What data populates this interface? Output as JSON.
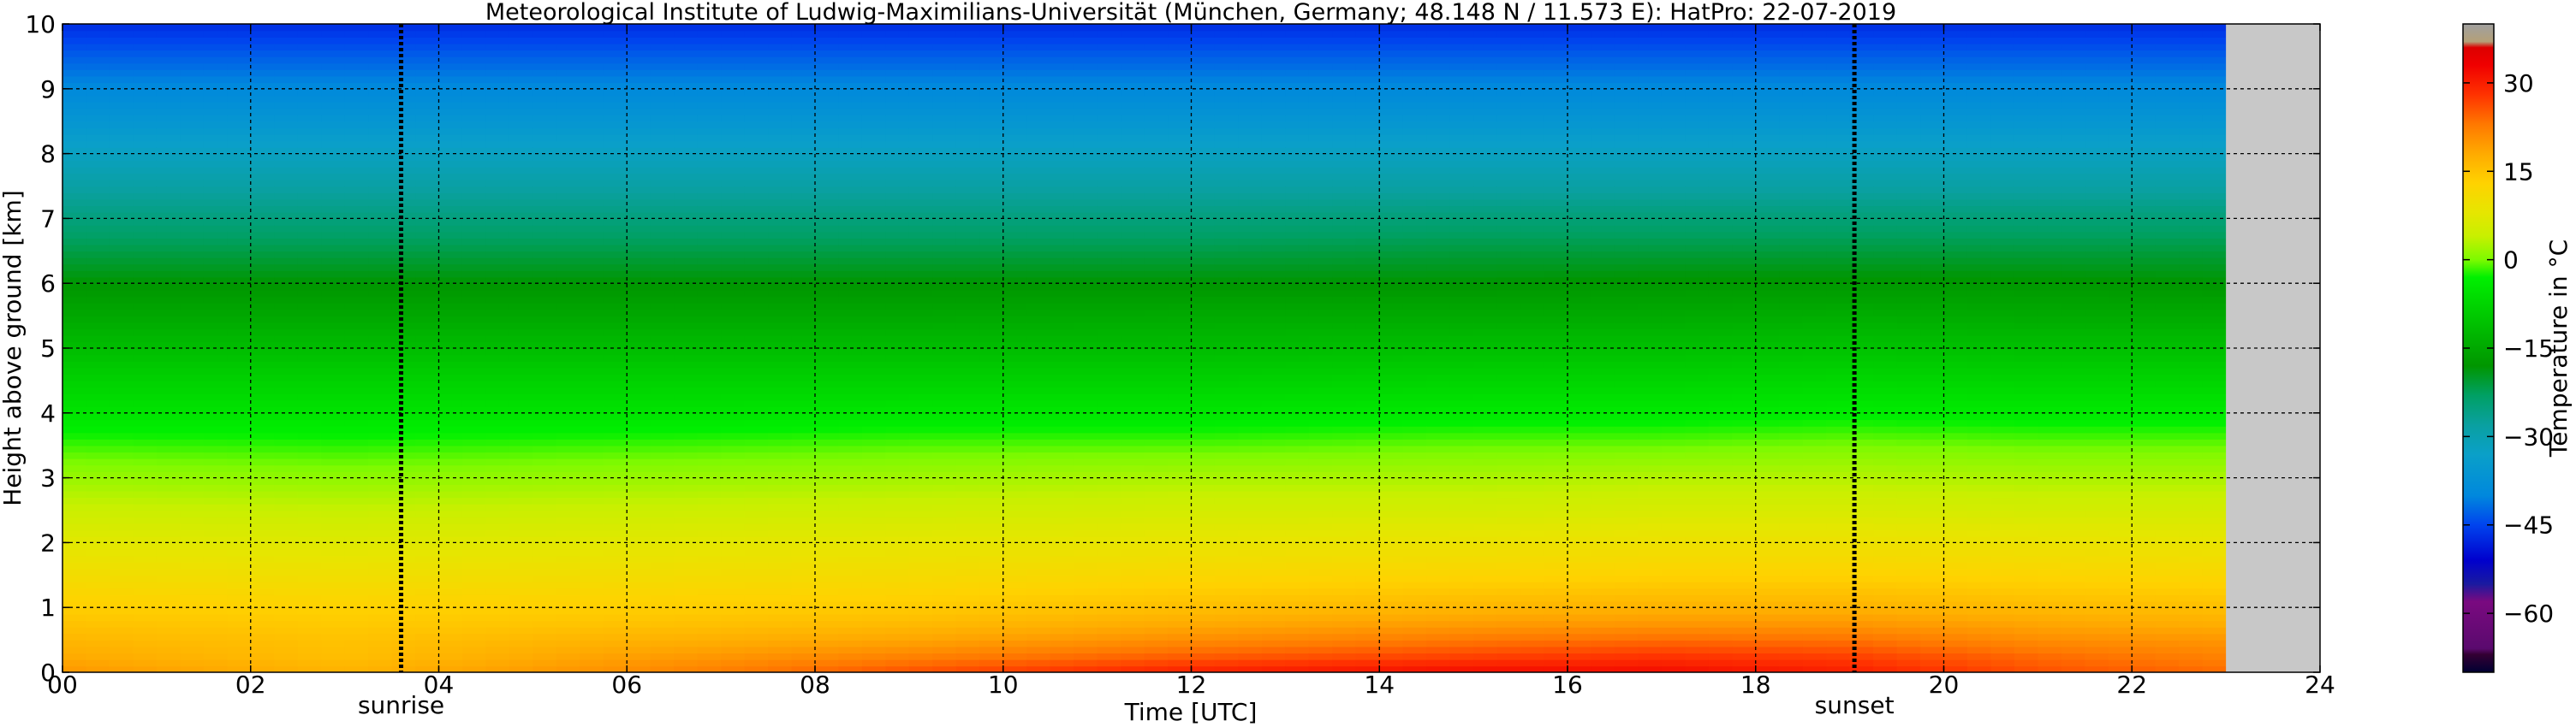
{
  "chart_data": {
    "type": "heatmap",
    "title": "Meteorological Institute of Ludwig-Maximilians-Universität (München, Germany; 48.148 N / 11.573 E):    HatPro: 22-07-2019",
    "xlabel": "Time [UTC]",
    "ylabel": "Height above ground [km]",
    "xlim": [
      0,
      24
    ],
    "ylim": [
      0,
      10
    ],
    "x_ticks": [
      0,
      2,
      4,
      6,
      8,
      10,
      12,
      14,
      16,
      18,
      20,
      22,
      24
    ],
    "x_tick_labels": [
      "00",
      "02",
      "04",
      "06",
      "08",
      "10",
      "12",
      "14",
      "16",
      "18",
      "20",
      "22",
      "24"
    ],
    "y_ticks": [
      0,
      1,
      2,
      3,
      4,
      5,
      6,
      7,
      8,
      9,
      10
    ],
    "y_tick_labels": [
      "0",
      "1",
      "2",
      "3",
      "4",
      "5",
      "6",
      "7",
      "8",
      "9",
      "10"
    ],
    "grid": true,
    "data_end_time": 23.0,
    "missing_color": "#c8c8c8",
    "heights_km": [
      0.0,
      0.25,
      0.5,
      0.75,
      1.0,
      1.5,
      2.0,
      2.5,
      3.0,
      3.5,
      4.0,
      4.5,
      5.0,
      5.5,
      6.0,
      6.5,
      7.0,
      7.5,
      8.0,
      8.5,
      9.0,
      9.5,
      10.0
    ],
    "temperature_profiles": [
      {
        "time": 0,
        "values": [
          20,
          18,
          16.5,
          15,
          13.5,
          10.5,
          7.5,
          4.5,
          1.5,
          -1.5,
          -5,
          -8,
          -11.5,
          -15,
          -18,
          -21.5,
          -25,
          -28.5,
          -32,
          -36,
          -39.5,
          -43,
          -47
        ]
      },
      {
        "time": 3,
        "values": [
          17,
          15.5,
          15,
          14,
          13,
          10,
          7,
          4,
          1,
          -2,
          -5,
          -8,
          -11.5,
          -15,
          -18,
          -21.5,
          -25,
          -28.5,
          -32,
          -36,
          -39.5,
          -43,
          -47
        ]
      },
      {
        "time": 6,
        "values": [
          21,
          19,
          17,
          15,
          13.5,
          10.5,
          7.5,
          4.5,
          1.5,
          -1.5,
          -5,
          -8,
          -11.5,
          -15,
          -18,
          -21.5,
          -25,
          -28.5,
          -32,
          -36,
          -39.5,
          -43,
          -47
        ]
      },
      {
        "time": 9,
        "values": [
          26,
          22,
          18.5,
          16,
          14,
          11,
          8,
          5,
          2,
          -1,
          -4.5,
          -8,
          -11.5,
          -15,
          -18,
          -21.5,
          -25,
          -28.5,
          -32,
          -36,
          -39.5,
          -43,
          -47
        ]
      },
      {
        "time": 12,
        "values": [
          30,
          25,
          21,
          18,
          15.5,
          12,
          8.5,
          5.5,
          2.5,
          -1,
          -4.5,
          -8,
          -11.5,
          -14.5,
          -18,
          -21.5,
          -25,
          -28.5,
          -32,
          -36,
          -39.5,
          -43,
          -47
        ]
      },
      {
        "time": 15,
        "values": [
          32,
          27,
          23,
          19.5,
          16.5,
          12.5,
          9,
          5.5,
          2.5,
          -0.5,
          -4,
          -7.5,
          -11,
          -14.5,
          -18,
          -21,
          -24.5,
          -28.5,
          -32,
          -36,
          -39.5,
          -43,
          -47
        ]
      },
      {
        "time": 17,
        "values": [
          32,
          28,
          24,
          20,
          17,
          13,
          9.5,
          6,
          3,
          -0.5,
          -4,
          -7.5,
          -11,
          -14.5,
          -17.5,
          -21,
          -24.5,
          -28.5,
          -32,
          -36,
          -39.5,
          -43,
          -47
        ]
      },
      {
        "time": 19,
        "values": [
          30,
          27,
          23.5,
          20,
          17,
          13,
          9.5,
          6,
          3,
          0,
          -3.5,
          -7,
          -10.5,
          -14,
          -17.5,
          -21,
          -24.5,
          -28.5,
          -32,
          -36,
          -39.5,
          -43,
          -47
        ]
      },
      {
        "time": 21,
        "values": [
          26,
          24,
          21,
          18.5,
          16,
          12.5,
          9,
          5.5,
          2.5,
          -0.5,
          -4,
          -7.5,
          -11,
          -14.5,
          -17.5,
          -21,
          -24.5,
          -28.5,
          -32,
          -36,
          -39.5,
          -43,
          -47
        ]
      },
      {
        "time": 23,
        "values": [
          24,
          22,
          20,
          17.5,
          15.5,
          12,
          8.5,
          5.5,
          2.5,
          -0.5,
          -4,
          -7.5,
          -11,
          -14.5,
          -18,
          -21,
          -24.5,
          -28.5,
          -32,
          -36,
          -39.5,
          -43,
          -47
        ]
      }
    ],
    "events": [
      {
        "label": "sunrise",
        "time": 3.6
      },
      {
        "label": "sunset",
        "time": 19.05
      }
    ],
    "colorbar": {
      "label": "Temperature in °C",
      "vmin": -70,
      "vmax": 40,
      "ticks": [
        30,
        15,
        0,
        -15,
        -30,
        -45,
        -60
      ],
      "tick_labels": [
        "30",
        "15",
        "0",
        "−15",
        "−30",
        "−45",
        "−60"
      ],
      "color_stops": [
        {
          "value": -70,
          "color": "#000033"
        },
        {
          "value": -67,
          "color": "#330033"
        },
        {
          "value": -66,
          "color": "#5a0a6e"
        },
        {
          "value": -58,
          "color": "#7a0a80"
        },
        {
          "value": -55,
          "color": "#1a1aa0"
        },
        {
          "value": -51,
          "color": "#0000cd"
        },
        {
          "value": -45,
          "color": "#0044ee"
        },
        {
          "value": -40,
          "color": "#0088dd"
        },
        {
          "value": -33,
          "color": "#0aa0c8"
        },
        {
          "value": -28,
          "color": "#0aa0a0"
        },
        {
          "value": -23,
          "color": "#00a064"
        },
        {
          "value": -18,
          "color": "#009600"
        },
        {
          "value": -13,
          "color": "#00b400"
        },
        {
          "value": -8,
          "color": "#00d200"
        },
        {
          "value": -3,
          "color": "#00f000"
        },
        {
          "value": 0,
          "color": "#7dfa00"
        },
        {
          "value": 4,
          "color": "#c8f000"
        },
        {
          "value": 8,
          "color": "#e6e600"
        },
        {
          "value": 13,
          "color": "#ffd200"
        },
        {
          "value": 18,
          "color": "#ffaa00"
        },
        {
          "value": 23,
          "color": "#ff7800"
        },
        {
          "value": 28,
          "color": "#ff3200"
        },
        {
          "value": 33,
          "color": "#f00000"
        },
        {
          "value": 36,
          "color": "#dc0000"
        },
        {
          "value": 37,
          "color": "#b4a078"
        },
        {
          "value": 40,
          "color": "#a0a0a0"
        }
      ]
    }
  }
}
